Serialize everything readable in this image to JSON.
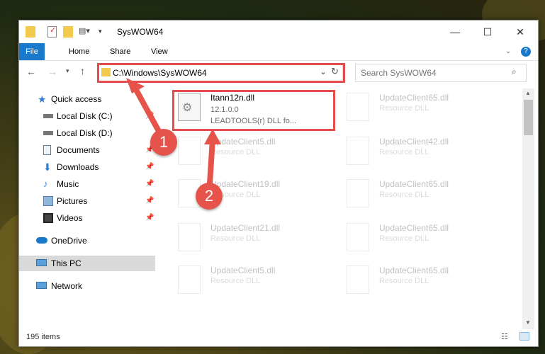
{
  "window": {
    "title": "SysWOW64",
    "minimize_glyph": "—",
    "maximize_glyph": "☐",
    "close_glyph": "✕"
  },
  "ribbon": {
    "tabs": [
      "File",
      "Home",
      "Share",
      "View"
    ]
  },
  "address": {
    "path": "C:\\Windows\\SysWOW64",
    "search_placeholder": "Search SysWOW64"
  },
  "sidebar": {
    "items": [
      {
        "label": "Quick access",
        "icon": "star-icon"
      },
      {
        "label": "Local Disk (C:)",
        "icon": "drive-icon"
      },
      {
        "label": "Local Disk (D:)",
        "icon": "drive-icon"
      },
      {
        "label": "Documents",
        "icon": "documents-icon"
      },
      {
        "label": "Downloads",
        "icon": "download-icon"
      },
      {
        "label": "Music",
        "icon": "music-icon"
      },
      {
        "label": "Pictures",
        "icon": "pictures-icon"
      },
      {
        "label": "Videos",
        "icon": "videos-icon"
      },
      {
        "label": "OneDrive",
        "icon": "cloud-icon"
      },
      {
        "label": "This PC",
        "icon": "computer-icon"
      },
      {
        "label": "Network",
        "icon": "network-icon"
      }
    ]
  },
  "files": [
    {
      "name": "Itann12n.dll",
      "version": "12.1.0.0",
      "desc": "LEADTOOLS(r) DLL fo..."
    },
    {
      "name": "UpdateClient65.dll",
      "desc": "Resource DLL"
    },
    {
      "name": "UpdateClient5.dll",
      "desc": "Resource DLL"
    },
    {
      "name": "UpdateClient42.dll",
      "desc": "Resource DLL"
    },
    {
      "name": "UpdateClient19.dll",
      "desc": "Resource DLL"
    },
    {
      "name": "UpdateClient65.dll",
      "desc": "Resource DLL"
    },
    {
      "name": "UpdateClient21.dll",
      "desc": "Resource DLL"
    },
    {
      "name": "UpdateClient65.dll",
      "desc": "Resource DLL"
    },
    {
      "name": "UpdateClient5.dll",
      "desc": "Resource DLL"
    },
    {
      "name": "UpdateClient65.dll",
      "desc": "Resource DLL"
    }
  ],
  "status": {
    "count": "195 items"
  },
  "annotations": {
    "step1": "1",
    "step2": "2",
    "accent": "#e74c4c"
  },
  "colors": {
    "file_tab": "#1979ca",
    "selected_nav": "#d9d9d9"
  }
}
